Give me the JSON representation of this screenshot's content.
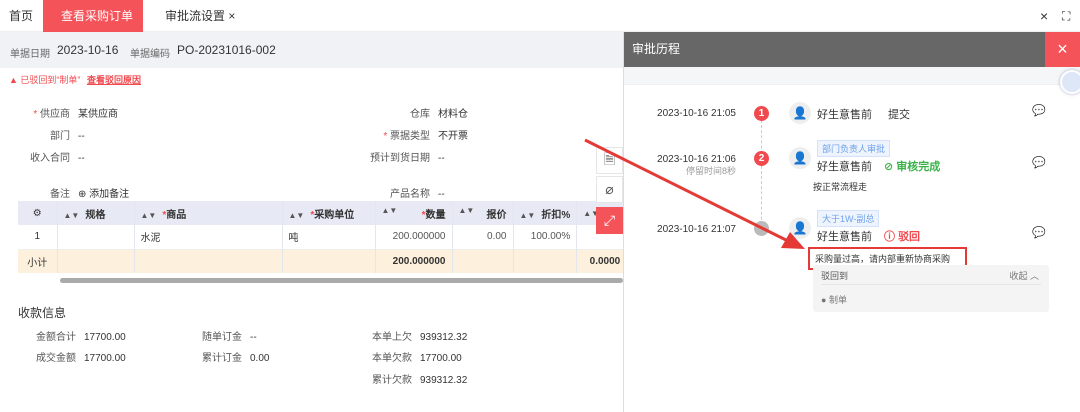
{
  "tabs": [
    {
      "label": "首页"
    },
    {
      "label": "查看采购订单",
      "close": "×"
    },
    {
      "label": "审批流设置",
      "close": "×"
    }
  ],
  "window_controls": {
    "close": "×",
    "fullscreen": "⛶"
  },
  "header": {
    "date_label": "单据日期",
    "date": "2023-10-16",
    "code_label": "单据编码",
    "code": "PO-20231016-002"
  },
  "alert": {
    "text": "已驳回到“制单”",
    "link": "查看驳回原因"
  },
  "fields": {
    "supplier": {
      "label": "供应商",
      "value": "某供应商"
    },
    "dept": {
      "label": "部门",
      "value": "--"
    },
    "contract": {
      "label": "收入合同",
      "value": "--"
    },
    "remark": {
      "label": "备注",
      "value": "添加备注"
    },
    "warehouse": {
      "label": "仓库",
      "value": "材料仓"
    },
    "invoice": {
      "label": "票据类型",
      "value": "不开票"
    },
    "arrival": {
      "label": "预计到货日期",
      "value": "--"
    },
    "product": {
      "label": "产品名称",
      "value": "--"
    }
  },
  "table": {
    "headers": [
      "规格",
      "商品",
      "采购单位",
      "数量",
      "报价",
      "折扣%"
    ],
    "row": {
      "index": "1",
      "spec": "",
      "product": "水泥",
      "unit": "吨",
      "qty": "200.000000",
      "price": "0.00",
      "discount": "100.00%"
    },
    "subtotal": {
      "label": "小计",
      "qty": "200.000000",
      "other": "0.0000"
    }
  },
  "payment": {
    "title": "收款信息",
    "total": {
      "label": "金额合计",
      "value": "17700.00"
    },
    "deal": {
      "label": "成交金额",
      "value": "17700.00"
    },
    "deposit": {
      "label": "随单订金",
      "value": "--"
    },
    "cum_deposit": {
      "label": "累计订金",
      "value": "0.00"
    },
    "prev_owe": {
      "label": "本单上欠",
      "value": "939312.32"
    },
    "owe": {
      "label": "本单欠款",
      "value": "17700.00"
    },
    "cum_owe": {
      "label": "累计欠款",
      "value": "939312.32"
    }
  },
  "drawer": {
    "title": "审批历程",
    "close": "×",
    "steps": [
      {
        "time": "2023-10-16 21:05",
        "num": "1",
        "name": "好生意售前",
        "action": "提交"
      },
      {
        "time": "2023-10-16 21:06",
        "stay": "停留时间8秒",
        "num": "2",
        "tag": "部门负责人审批",
        "name": "好生意售前",
        "action": "审核完成",
        "comment": "按正常流程走"
      },
      {
        "time": "2023-10-16 21:07",
        "tag": "大于1W-副总",
        "name": "好生意售前",
        "action": "驳回",
        "comment": "采购量过高，请内部重新协商采购",
        "reject_to_label": "驳回到",
        "collapse": "收起",
        "reject_to": "制单"
      }
    ]
  },
  "colors": {
    "accent": "#f5535a",
    "success": "#3bb34a",
    "tag": "#6ea0e8"
  }
}
